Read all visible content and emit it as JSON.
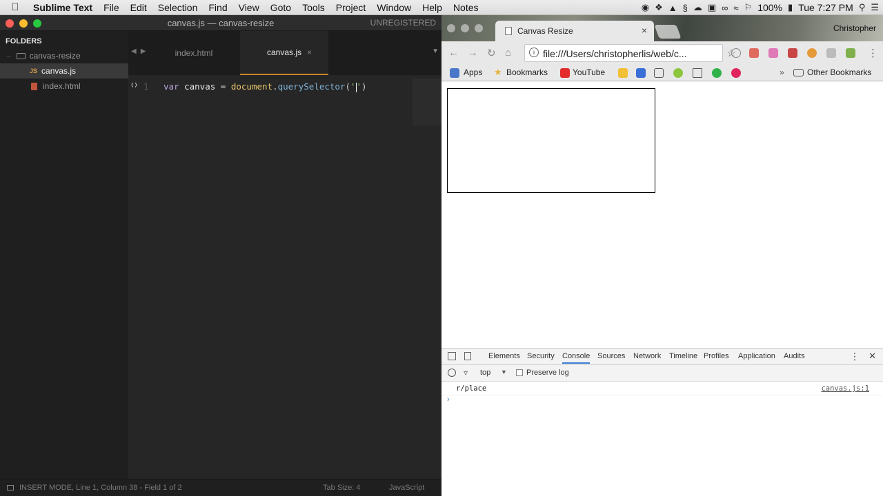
{
  "menubar": {
    "app_name": "Sublime Text",
    "items": [
      "File",
      "Edit",
      "Selection",
      "Find",
      "View",
      "Goto",
      "Tools",
      "Project",
      "Window",
      "Help",
      "Notes"
    ],
    "battery": "100%",
    "clock": "Tue 7:27 PM"
  },
  "sublime": {
    "title": "canvas.js — canvas-resize",
    "unregistered": "UNREGISTERED",
    "sidebar": {
      "header": "FOLDERS",
      "folder": "canvas-resize",
      "js_badge": "JS",
      "files": [
        "canvas.js",
        "index.html"
      ]
    },
    "tabs": [
      "index.html",
      "canvas.js"
    ],
    "tab_close": "×",
    "editor": {
      "line_number": "1",
      "code": {
        "kw": "var",
        "ident": " canvas ",
        "op": "= ",
        "obj": "document",
        "dot": ".",
        "fn": "querySelector",
        "open": "(",
        "str_open": "'",
        "str_close": "'",
        "close": ")"
      }
    },
    "status": {
      "mode": "INSERT MODE, Line 1, Column 38 - Field 1 of 2",
      "tab_size": "Tab Size: 4",
      "syntax": "JavaScript"
    }
  },
  "chrome": {
    "tab_title": "Canvas Resize",
    "user": "Christopher",
    "url": "file:///Users/christopherlis/web/c...",
    "bookmarks": [
      "Apps",
      "Bookmarks",
      "YouTube"
    ],
    "other_bookmarks": "Other Bookmarks",
    "devtools": {
      "tabs": [
        "Elements",
        "Security",
        "Console",
        "Sources",
        "Network",
        "Timeline",
        "Profiles",
        "Application",
        "Audits"
      ],
      "active_tab": "Console",
      "context": "top",
      "preserve_log": "Preserve log",
      "console_message": "r/place",
      "console_source": "canvas.js:1",
      "prompt": "›"
    }
  },
  "colors": {
    "accent": "#c8872b",
    "devtools_active": "#3a7bd5"
  }
}
